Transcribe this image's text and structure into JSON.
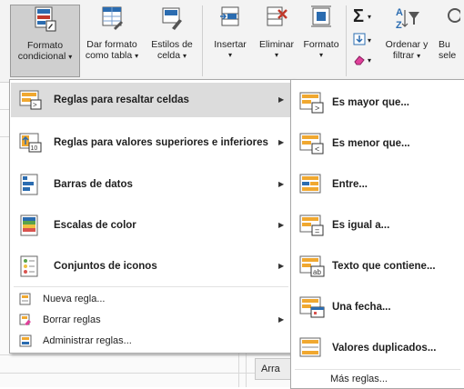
{
  "ribbon": {
    "conditional_format": {
      "line1": "Formato",
      "line2": "condicional",
      "caret": "▾"
    },
    "format_as_table": {
      "line1": "Dar formato",
      "line2": "como tabla",
      "caret": "▾"
    },
    "cell_styles": {
      "line1": "Estilos de",
      "line2": "celda",
      "caret": "▾"
    },
    "insert": {
      "label": "Insertar",
      "caret": "▾"
    },
    "delete": {
      "label": "Eliminar",
      "caret": "▾"
    },
    "format": {
      "label": "Formato",
      "caret": "▾"
    },
    "sort_filter": {
      "line1": "Ordenar y",
      "line2": "filtrar",
      "caret": "▾"
    },
    "find_select": {
      "line1": "Bu",
      "line2": "sele"
    },
    "autosum_symbol": "Σ",
    "sort_symbol": "A↓Z"
  },
  "main_menu": {
    "items": [
      {
        "label": "Reglas para resaltar celdas",
        "has_submenu": true
      },
      {
        "label": "Reglas para valores superiores e inferiores",
        "has_submenu": true
      },
      {
        "label": "Barras de datos",
        "has_submenu": true
      },
      {
        "label": "Escalas de color",
        "has_submenu": true
      },
      {
        "label": "Conjuntos de iconos",
        "has_submenu": true
      },
      {
        "label": "Nueva regla...",
        "has_submenu": false
      },
      {
        "label": "Borrar reglas",
        "has_submenu": true
      },
      {
        "label": "Administrar reglas...",
        "has_submenu": false
      }
    ],
    "highlighted_index": 0
  },
  "submenu": {
    "items": [
      {
        "label": "Es mayor que..."
      },
      {
        "label": "Es menor que..."
      },
      {
        "label": "Entre..."
      },
      {
        "label": "Es igual a..."
      },
      {
        "label": "Texto que contiene..."
      },
      {
        "label": "Una fecha..."
      },
      {
        "label": "Valores duplicados..."
      }
    ],
    "more_rules": "Más reglas..."
  },
  "sheet": {
    "partial_text": "Arra"
  },
  "colors": {
    "highlight": "#dcdcdc",
    "ribbon_bg": "#f3f3f3",
    "accent_blue": "#2b6cb0",
    "accent_orange": "#f0a830"
  }
}
